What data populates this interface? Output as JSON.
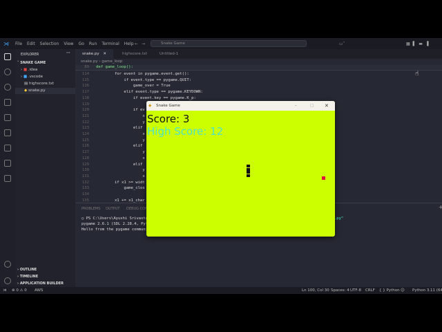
{
  "menu": [
    "File",
    "Edit",
    "Selection",
    "View",
    "Go",
    "Run",
    "Terminal",
    "Help"
  ],
  "search": "Snake Game",
  "sidebar": {
    "header": "EXPLORER",
    "folder": "SNAKE GAME",
    "files": [
      ".idea",
      ".vscode",
      "highscore.txt",
      "snake.py"
    ],
    "sections": [
      "OUTLINE",
      "TIMELINE",
      "APPLICATION BUILDER"
    ]
  },
  "tabs": [
    "snake.py",
    "highscore.txt",
    "Untitled-1"
  ],
  "breadcrumb": {
    "file": "snake.py",
    "symbol": "game_loop"
  },
  "sticky": {
    "line": "80",
    "code": "def game_loop():"
  },
  "code": [
    {
      "n": "114",
      "t": "        for event in pygame.event.get():"
    },
    {
      "n": "115",
      "t": "            if event.type == pygame.QUIT:"
    },
    {
      "n": "116",
      "t": "                game_over = True"
    },
    {
      "n": "117",
      "t": "            elif event.type == pygame.KEYDOWN:"
    },
    {
      "n": "118",
      "t": "                if event.key == pygame.K_p:"
    },
    {
      "n": "119",
      "t": ""
    },
    {
      "n": "120",
      "t": "                if ev"
    },
    {
      "n": "121",
      "t": "                    x"
    },
    {
      "n": "122",
      "t": "                    y"
    },
    {
      "n": "123",
      "t": "                elif"
    },
    {
      "n": "124",
      "t": "                    x"
    },
    {
      "n": "125",
      "t": "                    y"
    },
    {
      "n": "126",
      "t": "                elif"
    },
    {
      "n": "127",
      "t": "                    y"
    },
    {
      "n": "128",
      "t": "                    x"
    },
    {
      "n": "129",
      "t": "                elif"
    },
    {
      "n": "130",
      "t": "                    y"
    },
    {
      "n": "131",
      "t": "                    x"
    },
    {
      "n": "132",
      "t": "        if x1 >= widt"
    },
    {
      "n": "133",
      "t": "            game_clos"
    },
    {
      "n": "134",
      "t": ""
    },
    {
      "n": "135",
      "t": "        x1 += x1_char"
    }
  ],
  "panel": {
    "tabs": [
      "PROBLEMS",
      "OUTPUT",
      "DEBUG CONSOLE"
    ],
    "terminal": [
      "PS C:\\Users\\Ayushi Srivastava",
      "pygame 2.6.1 (SDL 2.28.4, Pyt",
      "Hello from the pygame communi"
    ],
    "terminal_tail": ".py\""
  },
  "status": {
    "left": [
      "⊗ 0 ⚠ 0",
      "AWS"
    ],
    "right": [
      "Ln 100, Col 30",
      "Spaces: 4",
      "UTF-8",
      "CRLF",
      "{ } Python",
      "Python 3.11 (64-bit)"
    ]
  },
  "game": {
    "title": "Snake Game",
    "score": "Score: 3",
    "high_score": "High Score: 12",
    "background": "#ccff00",
    "snake_color": "#111111",
    "food_color": "#e0113a",
    "score_color": "#111111",
    "high_score_color": "#4fe3c8"
  }
}
